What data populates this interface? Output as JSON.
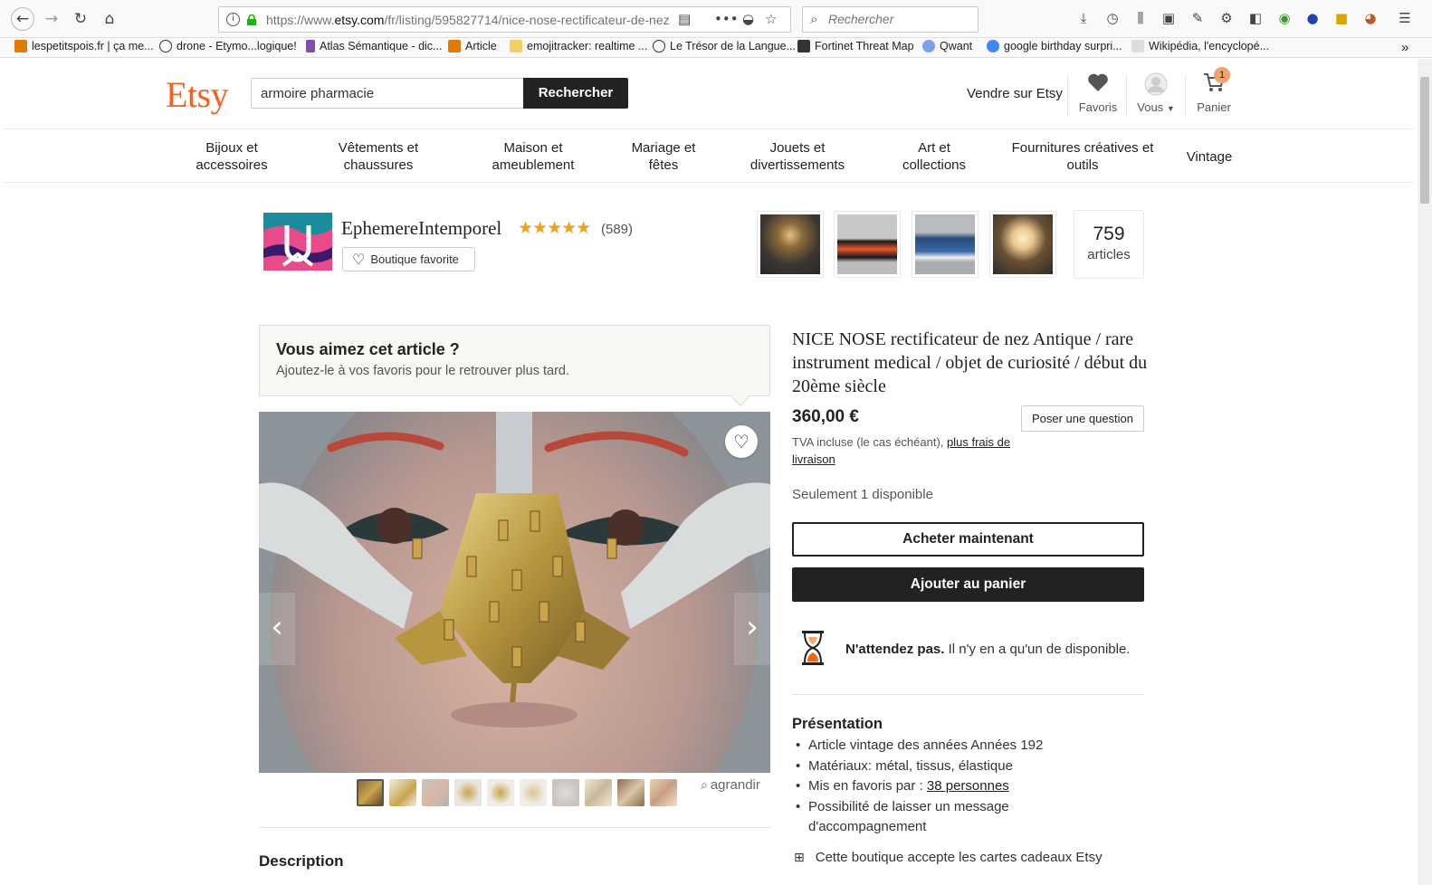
{
  "browser": {
    "url_prefix": "https://www.",
    "url_domain": "etsy.com",
    "url_path": "/fr/listing/595827714/nice-nose-rectificateur-de-nez",
    "search_placeholder": "Rechercher",
    "bookmarks": [
      {
        "label": "lespetitspois.fr | ça me..."
      },
      {
        "label": "drone - Etymo...logique!"
      },
      {
        "label": "Atlas Sémantique - dic..."
      },
      {
        "label": "Article"
      },
      {
        "label": "emojitracker: realtime ..."
      },
      {
        "label": "Le Trésor de la Langue..."
      },
      {
        "label": "Fortinet Threat Map"
      },
      {
        "label": "Qwant"
      },
      {
        "label": "google birthday surpri..."
      },
      {
        "label": "Wikipédia, l'encyclopé..."
      }
    ]
  },
  "header": {
    "logo": "Etsy",
    "search_value": "armoire pharmacie",
    "search_button": "Rechercher",
    "sell_link": "Vendre sur Etsy",
    "favorites_label": "Favoris",
    "you_label": "Vous",
    "cart_label": "Panier",
    "cart_count": "1"
  },
  "categories": [
    {
      "line1": "Bijoux et",
      "line2": "accessoires"
    },
    {
      "line1": "Vêtements et",
      "line2": "chaussures"
    },
    {
      "line1": "Maison et",
      "line2": "ameublement"
    },
    {
      "line1": "Mariage et",
      "line2": "fêtes"
    },
    {
      "line1": "Jouets et",
      "line2": "divertissements"
    },
    {
      "line1": "Art et",
      "line2": "collections"
    },
    {
      "line1": "Fournitures créatives et",
      "line2": "outils"
    },
    {
      "line1": "Vintage",
      "line2": ""
    }
  ],
  "shop": {
    "name": "EphemereIntemporel",
    "stars": "★★★★★",
    "rating": 5,
    "review_count": "(589)",
    "favorite_button": "Boutique favorite",
    "article_count": "759",
    "article_label": "articles"
  },
  "favorite_prompt": {
    "title": "Vous aimez cet article ?",
    "subtitle": "Ajoutez-le à vos favoris pour le retrouver plus tard."
  },
  "gallery": {
    "enlarge_label": "agrandir",
    "thumbnail_count": 10
  },
  "listing": {
    "title": "NICE NOSE rectificateur de nez Antique / rare instrument medical / objet de curiosité / début du 20ème siècle",
    "price": "360,00 €",
    "ask_button": "Poser une question",
    "vat_text": "TVA incluse (le cas échéant), ",
    "shipping_link": "plus frais de livraison",
    "stock_text": "Seulement 1 disponible",
    "buy_now": "Acheter maintenant",
    "add_to_cart": "Ajouter au panier",
    "urgency_bold": "N'attendez pas.",
    "urgency_text": " Il n'y en a qu'un de disponible.",
    "presentation_title": "Présentation",
    "presentation": {
      "item1": "Article vintage des années Années 192",
      "item2": "Matériaux: métal, tissus, élastique",
      "item3_prefix": "Mis en favoris par : ",
      "item3_link": "38 personnes",
      "item4": "Possibilité de laisser un message d'accompagnement"
    },
    "gift_cards": "Cette boutique accepte les cartes cadeaux Etsy",
    "description_title": "Description"
  }
}
